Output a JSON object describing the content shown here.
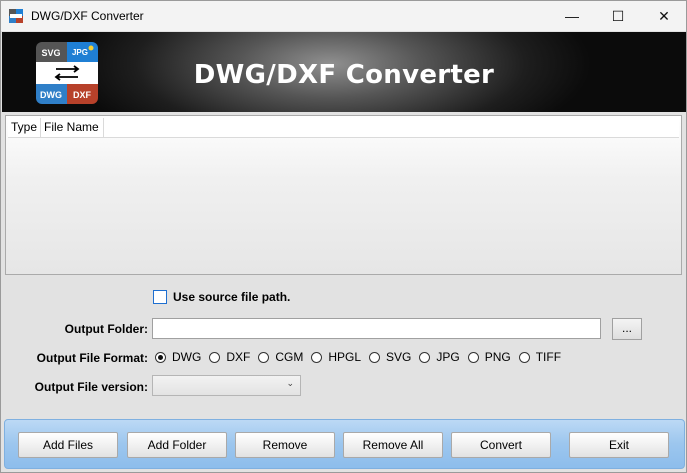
{
  "window": {
    "title": "DWG/DXF Converter",
    "minimize_glyph": "—",
    "maximize_glyph": "☐",
    "close_glyph": "✕"
  },
  "banner": {
    "title": "DWG/DXF Converter",
    "logo": {
      "top_left": "SVG",
      "top_right": "JPG",
      "bottom_left": "DWG",
      "bottom_right": "DXF",
      "colors": {
        "svg_bg": "#555555",
        "jpg_bg": "#1f7fd4",
        "dwg_bg": "#2f7fc8",
        "dxf_bg": "#b7412a"
      }
    }
  },
  "file_list": {
    "columns": [
      "Type",
      "File Name"
    ],
    "rows": []
  },
  "options": {
    "use_source_path_label": "Use source file path.",
    "use_source_path_checked": false,
    "output_folder_label": "Output Folder:",
    "output_folder_value": "",
    "browse_label": "...",
    "output_format_label": "Output File Format:",
    "formats": [
      "DWG",
      "DXF",
      "CGM",
      "HPGL",
      "SVG",
      "JPG",
      "PNG",
      "TIFF"
    ],
    "selected_format": "DWG",
    "output_version_label": "Output File version:",
    "output_version_value": ""
  },
  "actions": {
    "add_files": "Add Files",
    "add_folder": "Add Folder",
    "remove": "Remove",
    "remove_all": "Remove All",
    "convert": "Convert",
    "exit": "Exit"
  }
}
